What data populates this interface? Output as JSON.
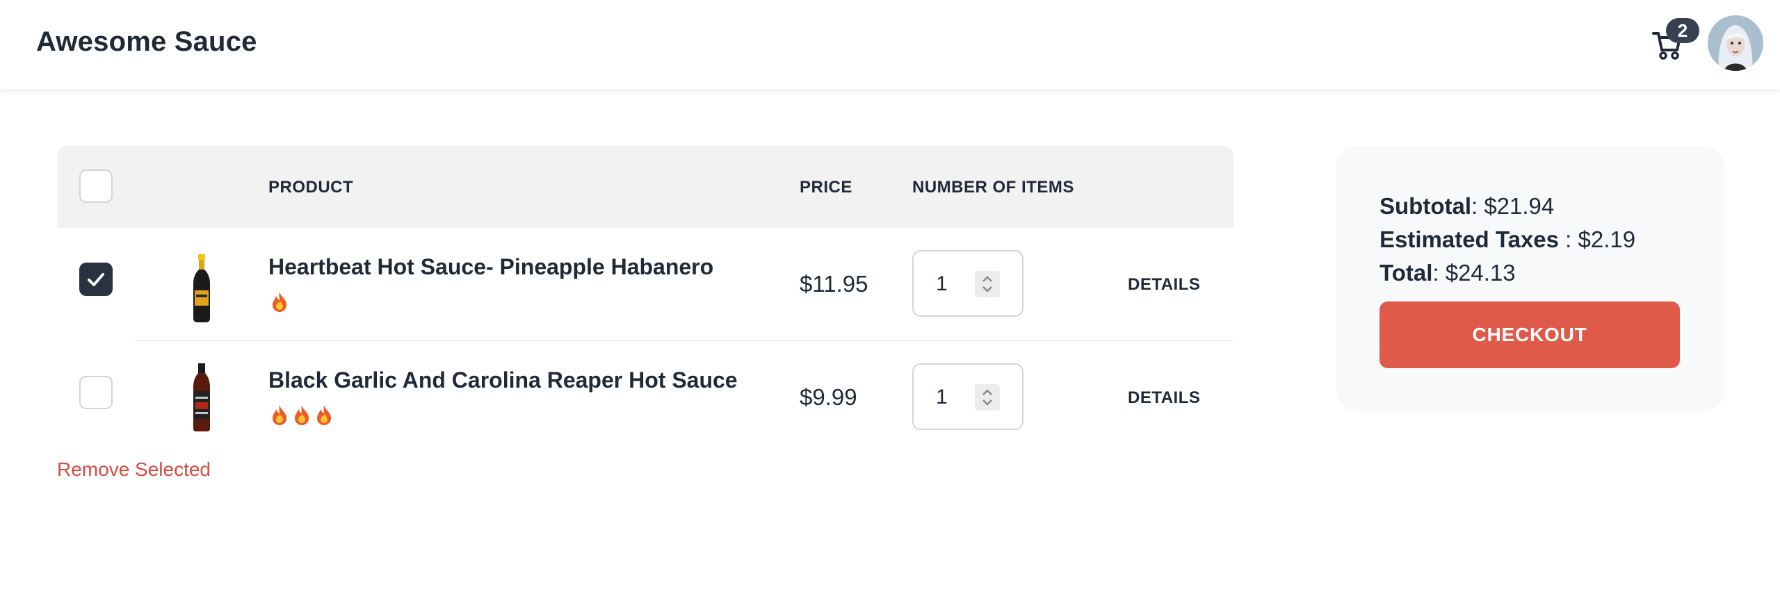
{
  "header": {
    "brand": "Awesome Sauce",
    "cart_count": "2",
    "cart_icon": "shopping-cart-icon",
    "avatar_icon": "user-avatar"
  },
  "table": {
    "columns": [
      "",
      "",
      "PRODUCT",
      "PRICE",
      "NUMBER OF ITEMS",
      ""
    ],
    "rows": [
      {
        "checked": true,
        "name": "Heartbeat Hot Sauce- Pineapple Habanero",
        "heat": 1,
        "price": "$11.95",
        "quantity": "1",
        "action": "DETAILS"
      },
      {
        "checked": false,
        "name": "Black Garlic And Carolina Reaper Hot Sauce",
        "heat": 3,
        "price": "$9.99",
        "quantity": "1",
        "action": "DETAILS"
      }
    ],
    "remove_label": "Remove Selected"
  },
  "summary": {
    "subtotal_label": "Subtotal",
    "subtotal_value": ": $21.94",
    "taxes_label": "Estimated Taxes",
    "taxes_value": " : $2.19",
    "total_label": "Total",
    "total_value": ": $24.13",
    "checkout_label": "CHECKOUT"
  },
  "colors": {
    "accent": "#e05a4a",
    "remove": "#d64c3f",
    "checkbox_checked": "#2a3140",
    "header_bg": "#f2f2f2"
  }
}
